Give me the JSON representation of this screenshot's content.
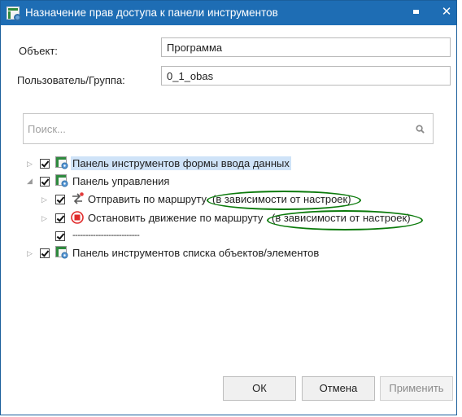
{
  "window": {
    "title": "Назначение прав доступа к панели инструментов",
    "minimize_icon": "minimize-icon",
    "close_label": "✕"
  },
  "form": {
    "object_label": "Объект:",
    "object_value": "Программа",
    "user_label": "Пользователь/Группа:",
    "user_value": "0_1_obas"
  },
  "search": {
    "placeholder": "Поиск...",
    "icon": "search-icon"
  },
  "tree": {
    "items": [
      {
        "label": "Панель инструментов формы ввода данных",
        "checked": true,
        "expanded": false,
        "selected": true,
        "icon": "toolbar-settings-icon"
      },
      {
        "label": "Панель управления",
        "checked": true,
        "expanded": true,
        "icon": "toolbar-settings-icon"
      },
      {
        "label": "Отправить по маршруту",
        "annotation": "(в зависимости от настроек)",
        "checked": true,
        "icon": "route-send-icon"
      },
      {
        "label": "Остановить движение по маршруту",
        "annotation": "(в зависимости от настроек)",
        "checked": true,
        "icon": "stop-route-icon"
      },
      {
        "label": "--------------------------",
        "checked": true
      },
      {
        "label": "Панель инструментов списка объектов/элементов",
        "checked": true,
        "expanded": false,
        "icon": "toolbar-settings-icon"
      }
    ]
  },
  "buttons": {
    "ok": "ОК",
    "cancel": "Отмена",
    "apply": "Применить"
  },
  "colors": {
    "titlebar": "#1e6db4",
    "highlight_ellipse": "#0b7a0b",
    "selection": "#cfe3f8"
  }
}
